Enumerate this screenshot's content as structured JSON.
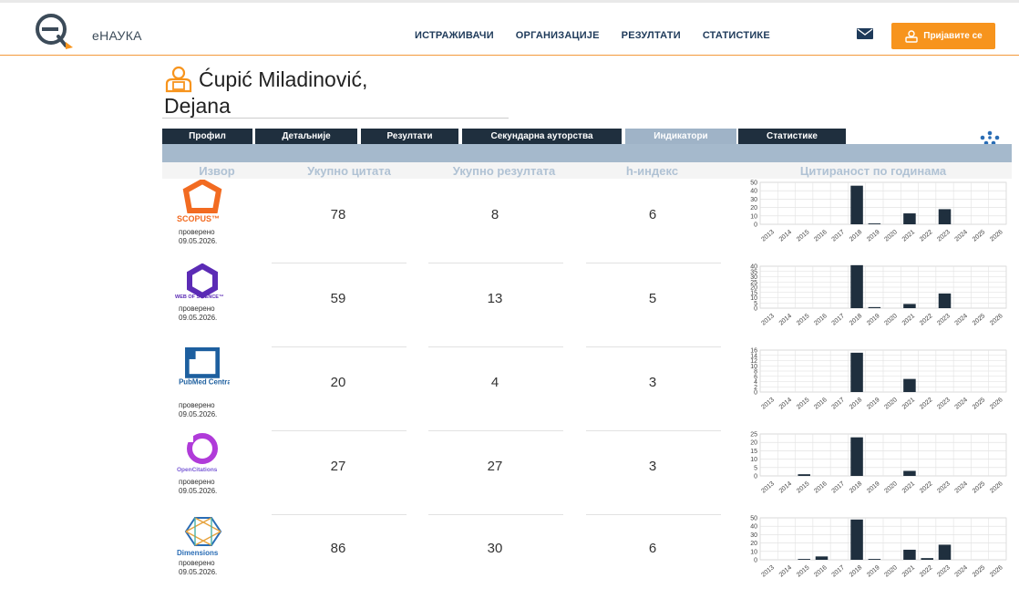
{
  "app": {
    "logo_text": "eНАУКА"
  },
  "nav": {
    "items": [
      "ИСТРАЖИВАЧИ",
      "ОРГАНИЗАЦИЈЕ",
      "РЕЗУЛТАТИ",
      "СТАТИСТИКЕ"
    ]
  },
  "header": {
    "login_label": "Пријавите се"
  },
  "person": {
    "name_line1": "Ćupić Miladinović,",
    "name_line2": "Dejana"
  },
  "tabs": [
    "Профил",
    "Детаљније",
    "Резултати",
    "Секундарна ауторства",
    "Индикатори",
    "Статистике"
  ],
  "active_tab": "Индикатори",
  "table": {
    "headers": [
      "Извор",
      "Укупно цитата",
      "Укупно резултата",
      "h-индекс",
      "Цитираност по годинама"
    ],
    "checked_label": "проверено",
    "rows": [
      {
        "source": "SCOPUS™",
        "checked_date": "09.05.2026.",
        "citations": "78",
        "results": "8",
        "h_index": "6"
      },
      {
        "source": "WEB OF SCIENCE™",
        "checked_date": "09.05.2026.",
        "citations": "59",
        "results": "13",
        "h_index": "5"
      },
      {
        "source": "PubMed Central",
        "checked_date": "09.05.2026.",
        "citations": "20",
        "results": "4",
        "h_index": "3"
      },
      {
        "source": "OpenCitations",
        "checked_date": "09.05.2026.",
        "citations": "27",
        "results": "27",
        "h_index": "3"
      },
      {
        "source": "Dimensions",
        "checked_date": "09.05.2026.",
        "citations": "86",
        "results": "30",
        "h_index": "6"
      }
    ]
  },
  "colors": {
    "accent": "#f7941d",
    "tab_dark": "#1f2f3e",
    "tab_active": "#9fb3c7",
    "bar": "#1f2f3e",
    "scopus": "#f26b21",
    "wos": "#5b2bb5",
    "pubmed": "#1d5f9f",
    "opencitations": "#b03bd9",
    "dimensions": "#2a6db5"
  },
  "chart_data": [
    {
      "type": "bar",
      "categories": [
        "2013",
        "2014",
        "2015",
        "2016",
        "2017",
        "2018",
        "2019",
        "2020",
        "2021",
        "2022",
        "2023",
        "2024",
        "2025",
        "2026"
      ],
      "values": [
        0,
        0,
        0,
        0,
        0,
        46,
        1,
        0,
        13,
        0,
        18,
        0,
        0,
        0
      ],
      "ylim": [
        0,
        50
      ],
      "yticks": [
        0,
        10,
        20,
        30,
        40,
        50
      ],
      "grid": true
    },
    {
      "type": "bar",
      "categories": [
        "2013",
        "2014",
        "2015",
        "2016",
        "2017",
        "2018",
        "2019",
        "2020",
        "2021",
        "2022",
        "2023",
        "2024",
        "2025",
        "2026"
      ],
      "values": [
        0,
        0,
        0,
        0,
        0,
        41,
        1,
        0,
        4,
        0,
        14,
        0,
        0,
        0
      ],
      "ylim": [
        0,
        40
      ],
      "yticks": [
        0,
        5,
        10,
        15,
        20,
        25,
        30,
        35,
        40
      ],
      "grid": true
    },
    {
      "type": "bar",
      "categories": [
        "2013",
        "2014",
        "2015",
        "2016",
        "2017",
        "2018",
        "2019",
        "2020",
        "2021",
        "2022",
        "2023",
        "2024",
        "2025",
        "2026"
      ],
      "values": [
        0,
        0,
        0,
        0,
        0,
        15,
        0,
        0,
        5,
        0,
        0,
        0,
        0,
        0
      ],
      "ylim": [
        0,
        16
      ],
      "yticks": [
        0,
        2,
        4,
        6,
        8,
        10,
        12,
        14,
        16
      ],
      "grid": true
    },
    {
      "type": "bar",
      "categories": [
        "2013",
        "2014",
        "2015",
        "2016",
        "2017",
        "2018",
        "2019",
        "2020",
        "2021",
        "2022",
        "2023",
        "2024",
        "2025",
        "2026"
      ],
      "values": [
        0,
        0,
        1,
        0,
        0,
        23,
        0,
        0,
        3,
        0,
        0,
        0,
        0,
        0
      ],
      "ylim": [
        0,
        25
      ],
      "yticks": [
        0,
        5,
        10,
        15,
        20,
        25
      ],
      "grid": true
    },
    {
      "type": "bar",
      "categories": [
        "2013",
        "2014",
        "2015",
        "2016",
        "2017",
        "2018",
        "2019",
        "2020",
        "2021",
        "2022",
        "2023",
        "2024",
        "2025",
        "2026"
      ],
      "values": [
        0,
        0,
        1,
        4,
        0,
        48,
        1,
        0,
        12,
        2,
        18,
        0,
        0,
        0
      ],
      "ylim": [
        0,
        50
      ],
      "yticks": [
        0,
        10,
        20,
        30,
        40,
        50
      ],
      "grid": true
    }
  ]
}
